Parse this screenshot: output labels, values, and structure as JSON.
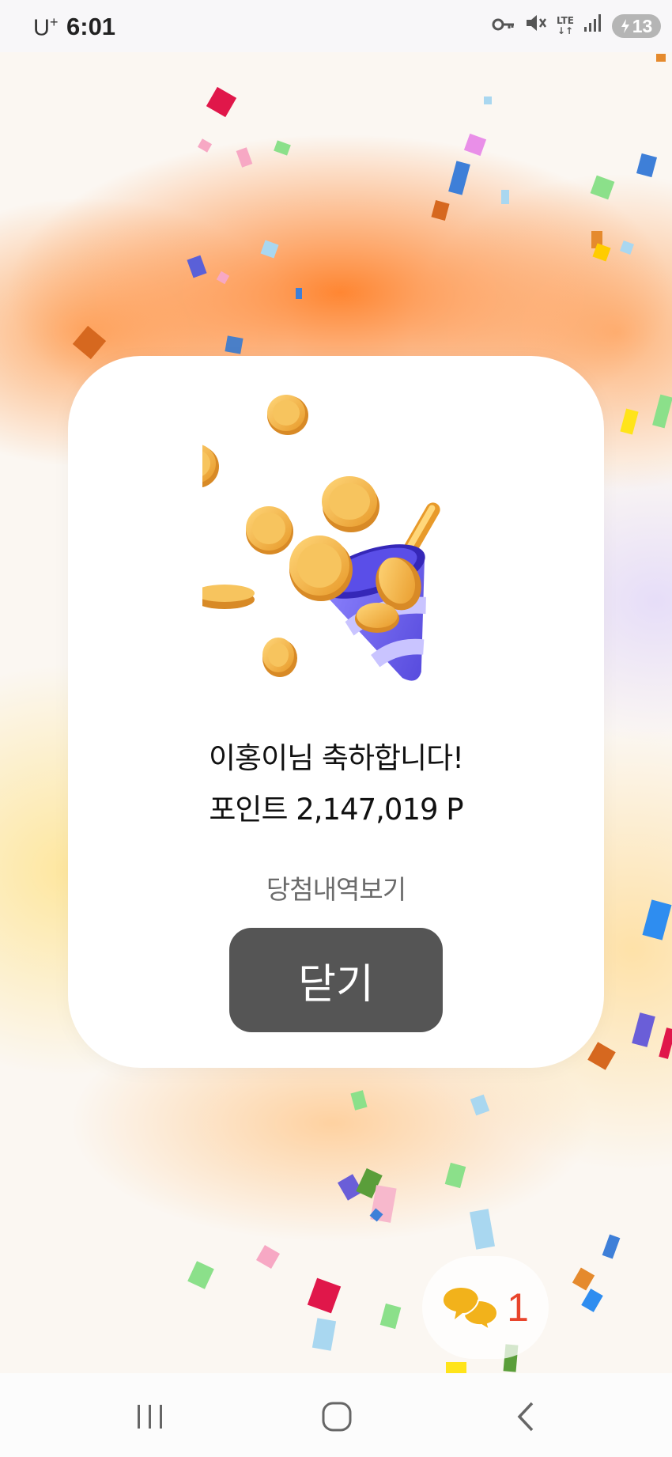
{
  "status_bar": {
    "carrier": "U",
    "carrier_sup": "+",
    "time": "6:01",
    "network": "LTE",
    "battery": "13",
    "icons": [
      "key-icon",
      "mute-icon",
      "lte-icon",
      "signal-icon",
      "battery-icon"
    ]
  },
  "dialog": {
    "illustration": "party-popper-with-coins",
    "congrats_text": "이홍이님 축하합니다!",
    "points_text": "포인트 2,147,019 P",
    "history_link": "당첨내역보기",
    "close_button": "닫기"
  },
  "chat_fab": {
    "icon": "chat-bubbles-icon",
    "count": "1"
  },
  "nav_bar": {
    "buttons": [
      "recent-apps",
      "home",
      "back"
    ]
  },
  "colors": {
    "button_bg": "#555555",
    "badge_count": "#e8442b",
    "coin": "#f2b544",
    "popper": "#6a5ee8"
  }
}
